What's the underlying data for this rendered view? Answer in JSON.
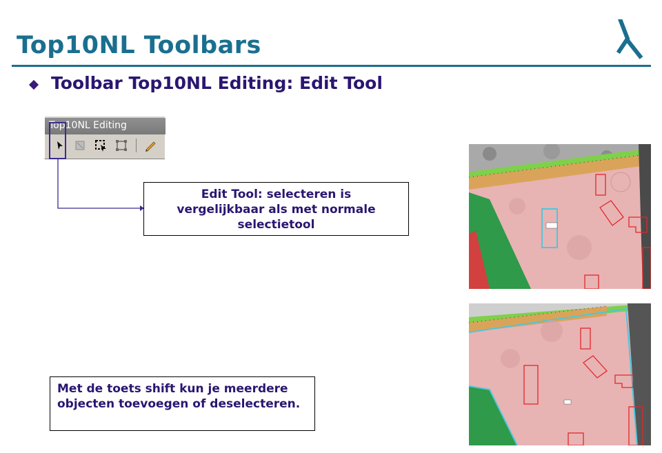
{
  "page": {
    "title": "Top10NL Toolbars",
    "subtitle": "Toolbar Top10NL Editing: Edit Tool"
  },
  "toolbar": {
    "title": "Top10NL Editing",
    "buttons": [
      {
        "icon": "arrow-pointer-icon",
        "label": "Edit Tool"
      },
      {
        "icon": "square-icon"
      },
      {
        "icon": "select-polygon-icon"
      },
      {
        "icon": "vertex-edit-icon"
      },
      {
        "icon": "pencil-icon"
      }
    ]
  },
  "callouts": {
    "edit_tool": "Edit Tool: selecteren is vergelijkbaar als met normale selectietool",
    "shift": "Met de toets shift kun je meerdere objecten toevoegen of deselecteren."
  },
  "colors": {
    "title": "#1a6f8f",
    "text": "#2a1670",
    "selection": "#3b2a8f",
    "map_pink": "#e8b3b3",
    "map_green": "#2e9a4a",
    "map_outline": "#e0282a",
    "map_select": "#4fc6dc"
  }
}
